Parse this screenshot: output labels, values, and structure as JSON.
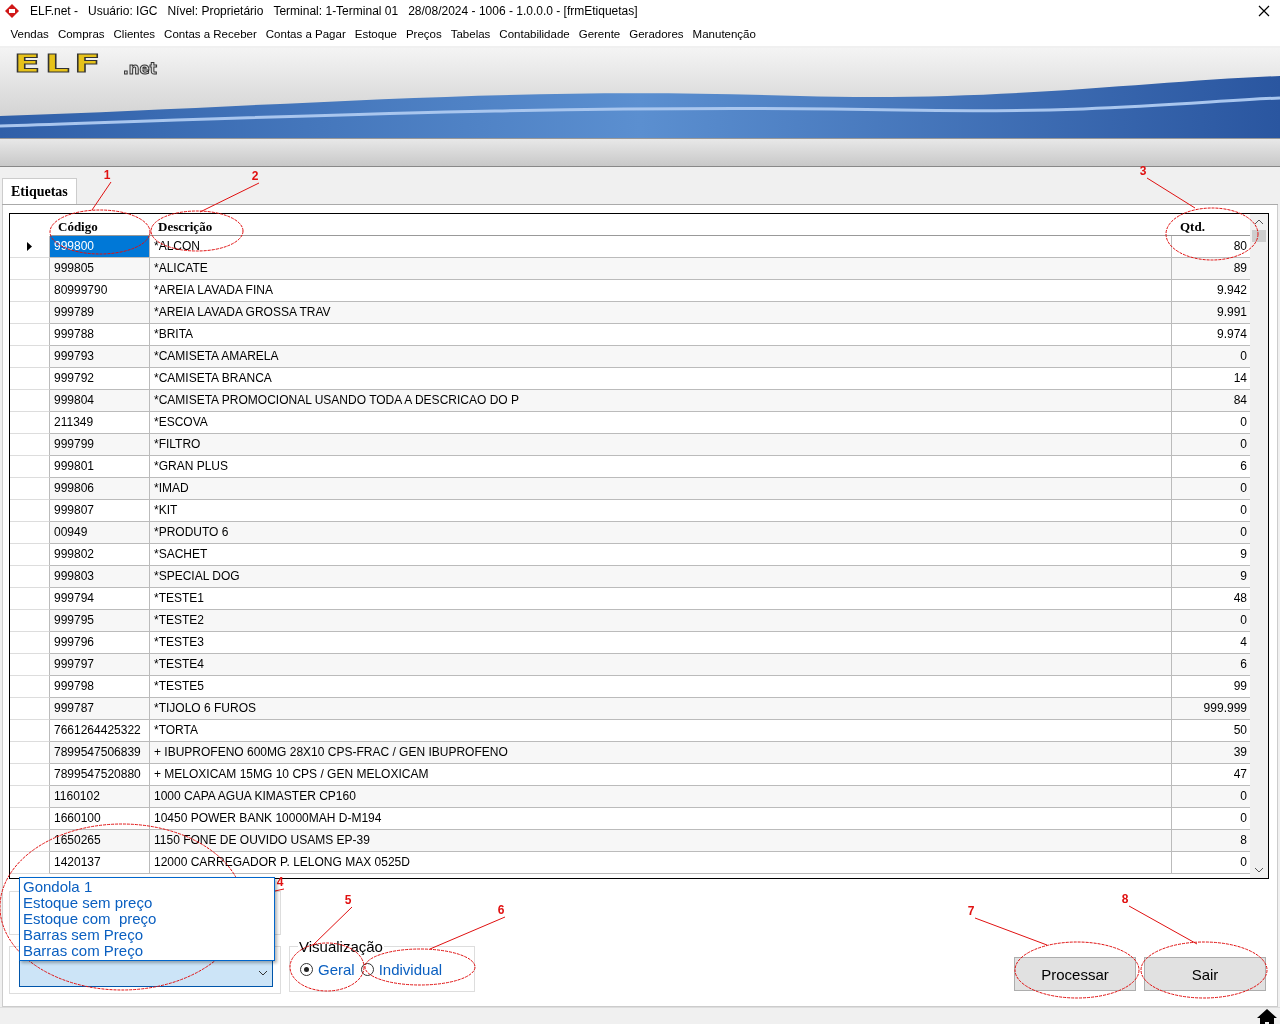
{
  "window": {
    "title_parts": [
      "ELF.net -",
      "Usuário: IGC",
      "Nível: Proprietário",
      "Terminal: 1-Terminal 01",
      "28/08/2024 - 1006 - 1.0.0.0 - [frmEtiquetas]"
    ]
  },
  "menu": [
    "Vendas",
    "Compras",
    "Clientes",
    "Contas a Receber",
    "Contas a Pagar",
    "Estoque",
    "Preços",
    "Tabelas",
    "Contabilidade",
    "Gerente",
    "Geradores",
    "Manutenção"
  ],
  "logo": {
    "name": "ELF",
    "suffix": ".net"
  },
  "tabs": [
    {
      "label": "Etiquetas",
      "selected": true
    }
  ],
  "table": {
    "columns": [
      "Código",
      "Descrição",
      "Qtd."
    ],
    "rows": [
      {
        "code": "999800",
        "description": "*ALCON",
        "qty": "80",
        "selected": true
      },
      {
        "code": "999805",
        "description": "*ALICATE",
        "qty": "89",
        "selected": false
      },
      {
        "code": "80999790",
        "description": "*AREIA LAVADA FINA",
        "qty": "9.942",
        "selected": false
      },
      {
        "code": "999789",
        "description": "*AREIA LAVADA GROSSA TRAV",
        "qty": "9.991",
        "selected": false
      },
      {
        "code": "999788",
        "description": "*BRITA",
        "qty": "9.974",
        "selected": false
      },
      {
        "code": "999793",
        "description": "*CAMISETA AMARELA",
        "qty": "0",
        "selected": false
      },
      {
        "code": "999792",
        "description": "*CAMISETA BRANCA",
        "qty": "14",
        "selected": false
      },
      {
        "code": "999804",
        "description": "*CAMISETA PROMOCIONAL USANDO TODA A DESCRICAO DO P",
        "qty": "84",
        "selected": false
      },
      {
        "code": "211349",
        "description": "*ESCOVA",
        "qty": "0",
        "selected": false
      },
      {
        "code": "999799",
        "description": "*FILTRO",
        "qty": "0",
        "selected": false
      },
      {
        "code": "999801",
        "description": "*GRAN PLUS",
        "qty": "6",
        "selected": false
      },
      {
        "code": "999806",
        "description": "*IMAD",
        "qty": "0",
        "selected": false
      },
      {
        "code": "999807",
        "description": "*KIT",
        "qty": "0",
        "selected": false
      },
      {
        "code": "00949",
        "description": "*PRODUTO 6",
        "qty": "0",
        "selected": false
      },
      {
        "code": "999802",
        "description": "*SACHET",
        "qty": "9",
        "selected": false
      },
      {
        "code": "999803",
        "description": "*SPECIAL DOG",
        "qty": "9",
        "selected": false
      },
      {
        "code": "999794",
        "description": "*TESTE1",
        "qty": "48",
        "selected": false
      },
      {
        "code": "999795",
        "description": "*TESTE2",
        "qty": "0",
        "selected": false
      },
      {
        "code": "999796",
        "description": "*TESTE3",
        "qty": "4",
        "selected": false
      },
      {
        "code": "999797",
        "description": "*TESTE4",
        "qty": "6",
        "selected": false
      },
      {
        "code": "999798",
        "description": "*TESTE5",
        "qty": "99",
        "selected": false
      },
      {
        "code": "999787",
        "description": "*TIJOLO 6 FUROS",
        "qty": "999.999",
        "selected": false
      },
      {
        "code": "7661264425322",
        "description": "*TORTA",
        "qty": "50",
        "selected": false
      },
      {
        "code": "7899547506839",
        "description": "+ IBUPROFENO 600MG 28X10 CPS-FRAC / GEN IBUPROFENO",
        "qty": "39",
        "selected": false
      },
      {
        "code": "7899547520880",
        "description": "+ MELOXICAM 15MG 10 CPS / GEN MELOXICAM",
        "qty": "47",
        "selected": false
      },
      {
        "code": "1160102",
        "description": "1000 CAPA AGUA KIMASTER CP160",
        "qty": "0",
        "selected": false
      },
      {
        "code": "1660100",
        "description": "10450 POWER BANK 10000MAH D-M194",
        "qty": "0",
        "selected": false
      },
      {
        "code": "1650265",
        "description": "1150 FONE DE OUVIDO USAMS EP-39",
        "qty": "8",
        "selected": false
      },
      {
        "code": "1420137",
        "description": "12000 CARREGADOR P. LELONG MAX 0525D",
        "qty": "0",
        "selected": false
      }
    ]
  },
  "dropdown": {
    "options": [
      "Gondola 1",
      "Estoque sem preço",
      "Estoque com  preço",
      "Barras sem Preço",
      "Barras com Preço"
    ]
  },
  "visualizacao": {
    "title": "Visualização",
    "options": [
      {
        "label": "Geral",
        "selected": true
      },
      {
        "label": "Individual",
        "selected": false
      }
    ]
  },
  "buttons": [
    "Processar",
    "Sair"
  ],
  "annotations": [
    "1",
    "2",
    "3",
    "4",
    "5",
    "6",
    "7",
    "8"
  ]
}
